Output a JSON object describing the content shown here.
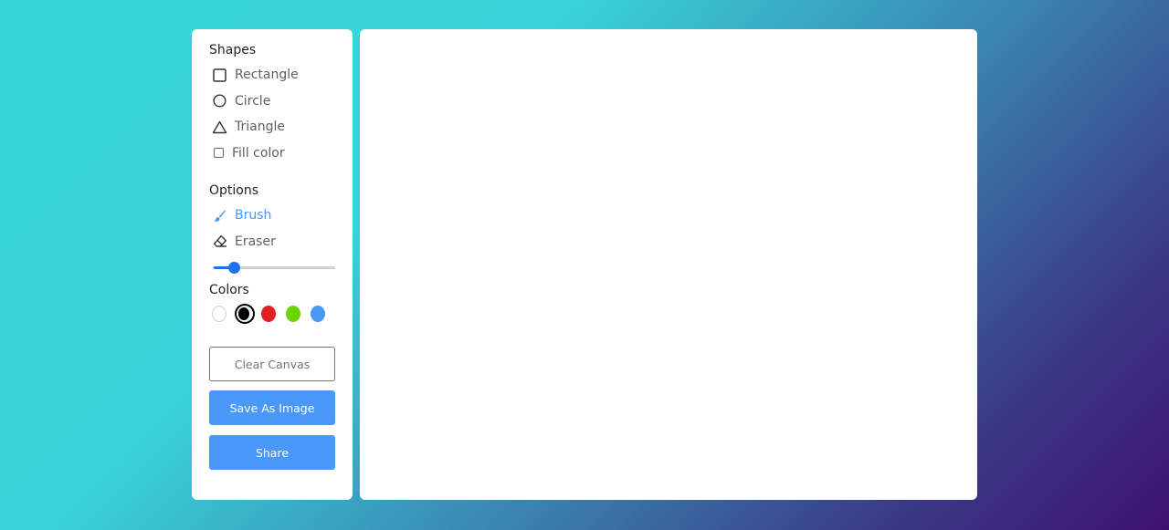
{
  "shapes": {
    "title": "Shapes",
    "items": [
      {
        "label": "Rectangle",
        "icon": "rectangle-icon"
      },
      {
        "label": "Circle",
        "icon": "circle-icon"
      },
      {
        "label": "Triangle",
        "icon": "triangle-icon"
      }
    ],
    "fill_color_label": "Fill color",
    "fill_color_checked": false
  },
  "options": {
    "title": "Options",
    "items": [
      {
        "label": "Brush",
        "icon": "brush-icon",
        "active": true
      },
      {
        "label": "Eraser",
        "icon": "eraser-icon",
        "active": false
      }
    ],
    "brush_size_fraction": 0.17
  },
  "colors": {
    "title": "Colors",
    "swatches": [
      "#ffffff",
      "#000000",
      "#e02020",
      "#6dd400",
      "#4a98f7"
    ],
    "selected_index": 1
  },
  "buttons": {
    "clear_label": "Clear Canvas",
    "save_label": "Save As Image",
    "share_label": "Share"
  },
  "theme": {
    "accent": "#4a98f7",
    "slider": "#1a73e8"
  }
}
